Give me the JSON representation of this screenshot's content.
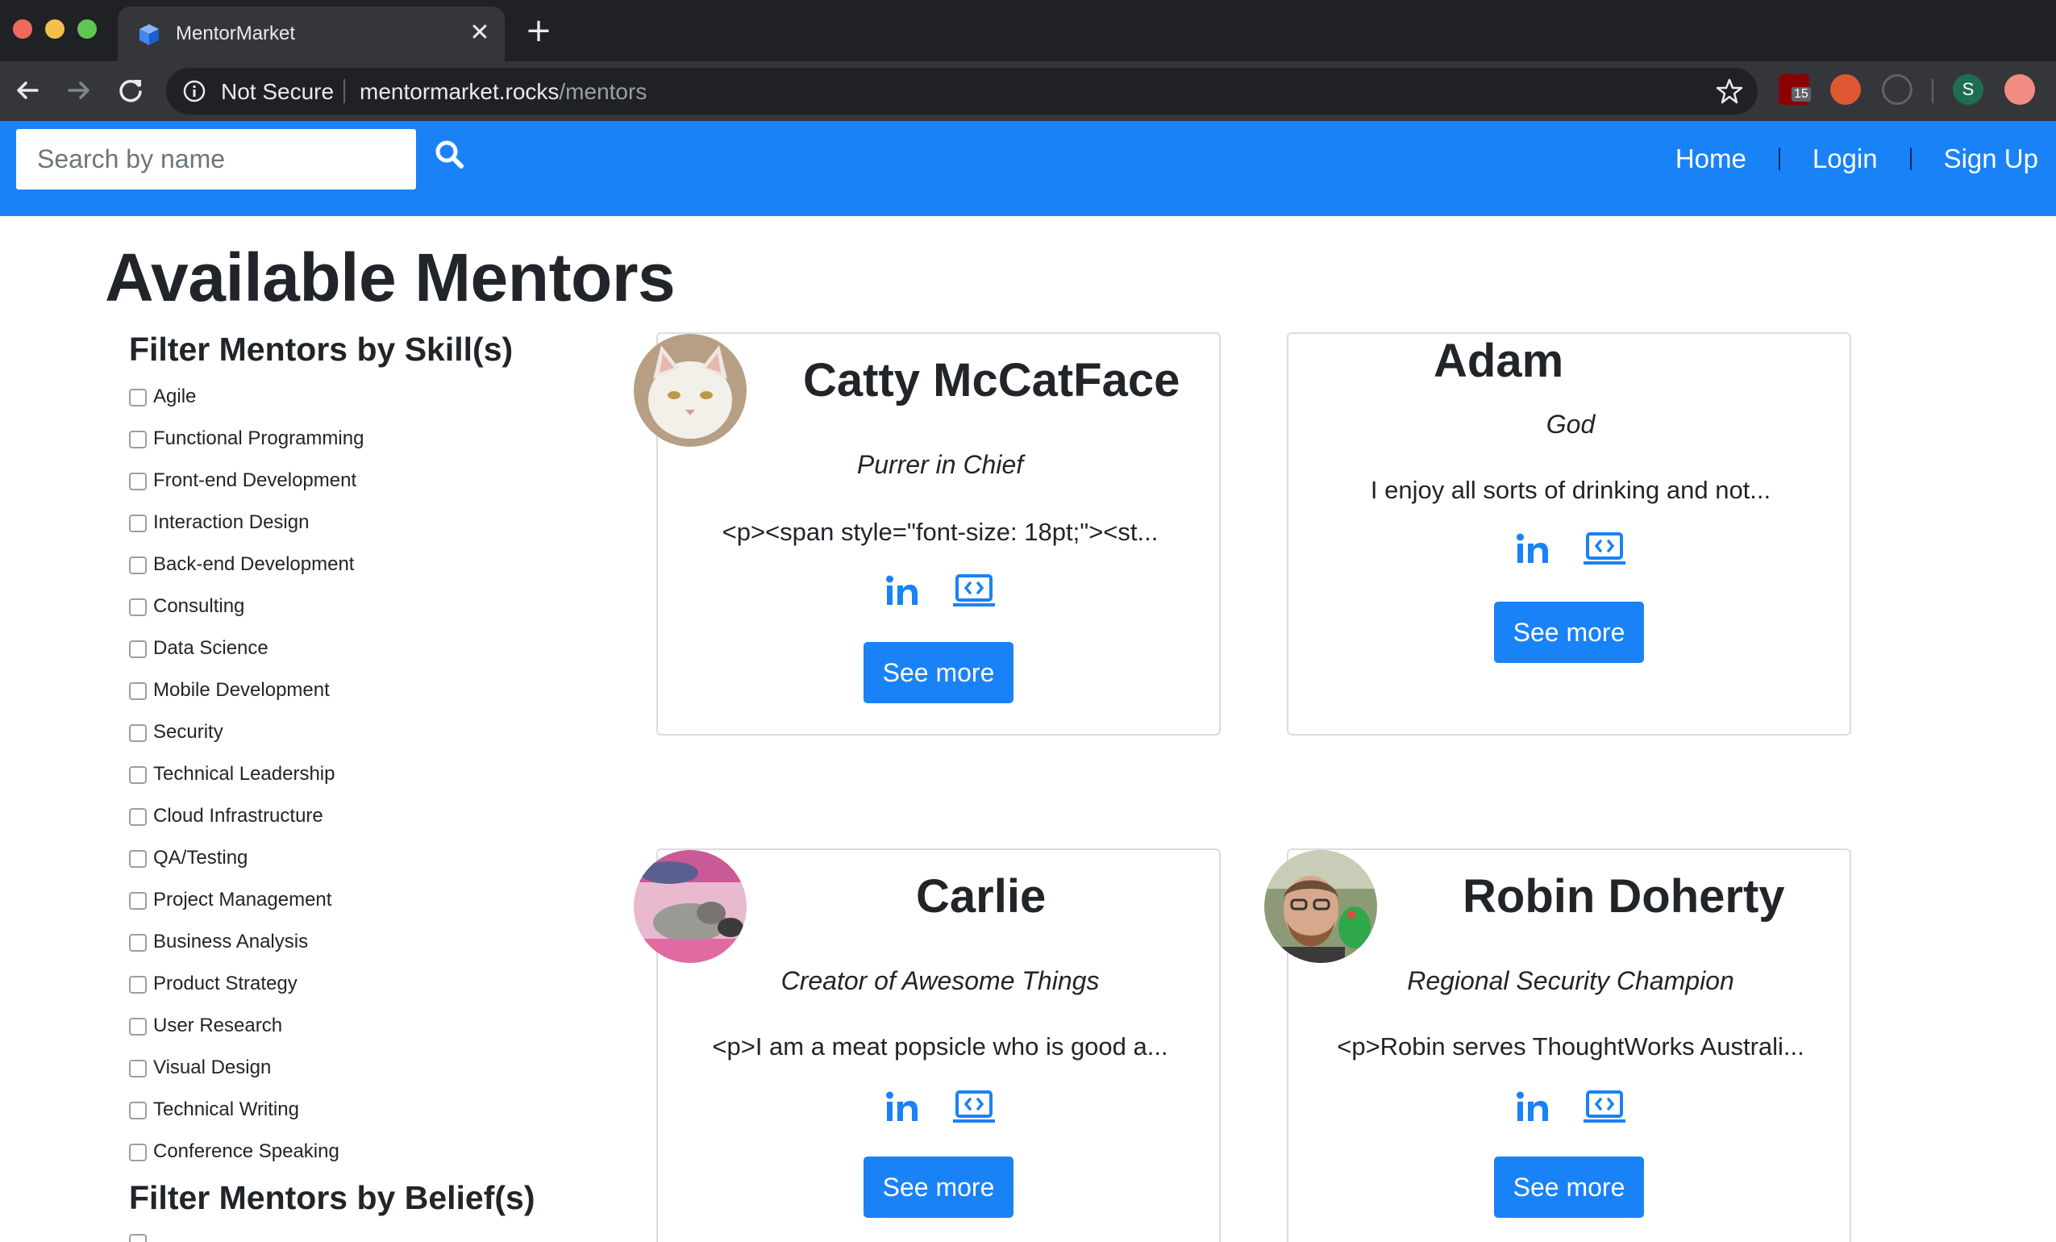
{
  "browser": {
    "tab_title": "MentorMarket",
    "tab_close": "✕",
    "new_tab": "+",
    "security_label": "Not Secure",
    "url_host": "mentormarket.rocks",
    "url_path": "/mentors",
    "extensions": [
      {
        "name": "ublock",
        "badge": "15",
        "color": "#8b0000"
      },
      {
        "name": "duckduckgo",
        "color": "#de5833"
      },
      {
        "name": "info",
        "color": "#5f6368"
      },
      {
        "name": "profile",
        "letter": "S",
        "color": "#1e6e52"
      },
      {
        "name": "addon",
        "color": "#f28b82"
      }
    ]
  },
  "header": {
    "search_placeholder": "Search by name",
    "nav": {
      "home": "Home",
      "login": "Login",
      "signup": "Sign Up"
    },
    "accent_color": "#1a82f7"
  },
  "page": {
    "title": "Available Mentors",
    "skills_heading": "Filter Mentors by Skill(s)",
    "skills": [
      "Agile",
      "Functional Programming",
      "Front-end Development",
      "Interaction Design",
      "Back-end Development",
      "Consulting",
      "Data Science",
      "Mobile Development",
      "Security",
      "Technical Leadership",
      "Cloud Infrastructure",
      "QA/Testing",
      "Project Management",
      "Business Analysis",
      "Product Strategy",
      "User Research",
      "Visual Design",
      "Technical Writing",
      "Conference Speaking"
    ],
    "beliefs_heading": "Filter Mentors by Belief(s)"
  },
  "mentors": [
    {
      "name": "Catty McCatFace",
      "title": "Purrer in Chief",
      "bio": "<p><span style=\"font-size: 18pt;\"><st...",
      "button": "See more",
      "avatar": "white-cat-photo"
    },
    {
      "name": "Adam",
      "title": "God",
      "bio": "I enjoy all sorts of drinking and not...",
      "button": "See more",
      "avatar": null
    },
    {
      "name": "Carlie",
      "title": "Creator of Awesome Things",
      "bio": "<p>I am a meat popsicle who is good a...",
      "button": "See more",
      "avatar": "cat-on-pink-blanket-photo"
    },
    {
      "name": "Robin Doherty",
      "title": "Regional Security Champion",
      "bio": "<p>Robin serves ThoughtWorks Australi...",
      "button": "See more",
      "avatar": "bearded-man-with-parrot-photo"
    }
  ]
}
